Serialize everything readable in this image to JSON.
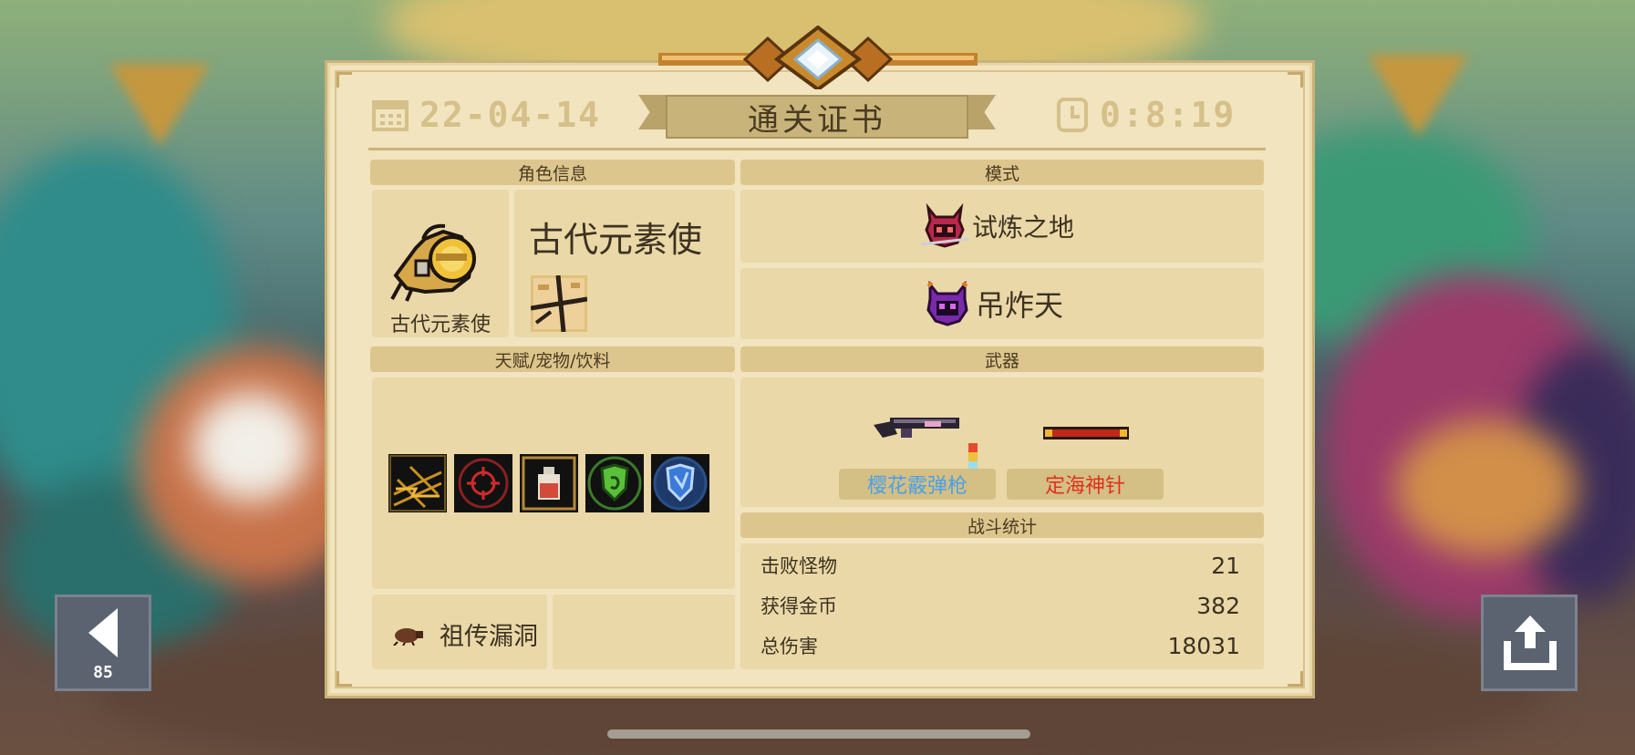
{
  "certificate": {
    "date": "22-04-14",
    "time": "0:8:19",
    "title": "通关证书"
  },
  "sections": {
    "character_header": "角色信息",
    "mode_header": "模式",
    "talents_header": "天赋/宠物/饮料",
    "weapons_header": "武器",
    "battle_header": "战斗统计"
  },
  "character": {
    "name_large": "古代元素使",
    "name_small": "古代元素使"
  },
  "modes": [
    {
      "label": "试炼之地"
    },
    {
      "label": "吊炸天"
    }
  ],
  "pet": {
    "label": "祖传漏洞"
  },
  "talents": [
    {
      "icon": "lightning-grid-icon",
      "border": "#6b5520"
    },
    {
      "icon": "crosshair-icon",
      "border": "#8a2020"
    },
    {
      "icon": "potion-bottle-icon",
      "border": "#b58a3a"
    },
    {
      "icon": "green-shield-icon",
      "border": "#3b7a2a"
    },
    {
      "icon": "blue-shield-icon",
      "border": "#2a4f8a"
    }
  ],
  "weapons": [
    {
      "name": "樱花霰弹枪",
      "color": "#4aa0e6"
    },
    {
      "name": "定海神针",
      "color": "#e0301c"
    }
  ],
  "battle_stats": [
    {
      "label": "击败怪物",
      "value": "21"
    },
    {
      "label": "获得金币",
      "value": "382"
    },
    {
      "label": "总伤害",
      "value": "18031"
    }
  ],
  "back_button": {
    "countdown": "85"
  },
  "colors": {
    "card": "#f1e4bf",
    "panel": "#e6d29d",
    "header": "#ddc68d",
    "faded_text": "#d5c08a"
  }
}
